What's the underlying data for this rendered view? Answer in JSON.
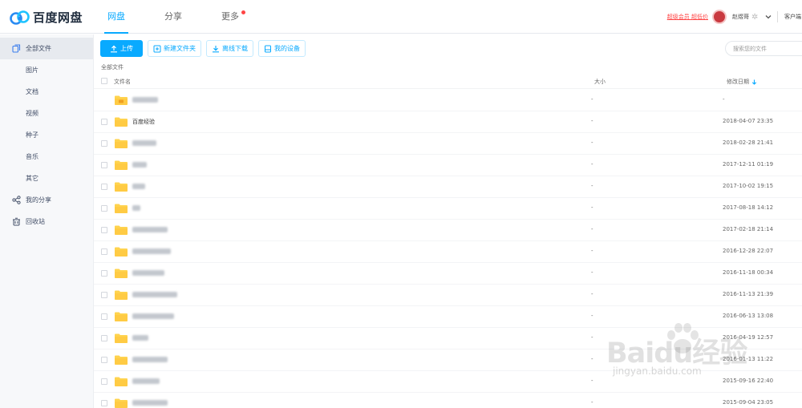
{
  "header": {
    "logo_text": "百度网盘",
    "nav": [
      {
        "label": "网盘",
        "active": true
      },
      {
        "label": "分享",
        "active": false
      },
      {
        "label": "更多",
        "active": false,
        "dot": true
      }
    ],
    "vip_link": "超级会员 超低价",
    "user_name": "赵煜哥",
    "client_link": "客户端"
  },
  "sidebar": {
    "items": [
      {
        "label": "全部文件",
        "icon": "files-icon",
        "active": true
      },
      {
        "label": "图片"
      },
      {
        "label": "文档"
      },
      {
        "label": "视频"
      },
      {
        "label": "种子"
      },
      {
        "label": "音乐"
      },
      {
        "label": "其它"
      },
      {
        "label": "我的分享",
        "icon": "share-icon"
      },
      {
        "label": "回收站",
        "icon": "trash-icon"
      }
    ]
  },
  "toolbar": {
    "upload_label": "上传",
    "new_folder_label": "新建文件夹",
    "offline_download_label": "离线下载",
    "my_devices_label": "我的设备",
    "search_placeholder": "搜索您的文件"
  },
  "breadcrumb": "全部文件",
  "table": {
    "columns": {
      "name": "文件名",
      "size": "大小",
      "date": "修改日期"
    },
    "rows": [
      {
        "name": "",
        "size": "-",
        "date": "-",
        "special": true
      },
      {
        "name": "百度经验",
        "size": "-",
        "date": "2018-04-07 23:35"
      },
      {
        "name": "",
        "size": "-",
        "date": "2018-02-28 21:41"
      },
      {
        "name": "",
        "size": "-",
        "date": "2017-12-11 01:19"
      },
      {
        "name": "",
        "size": "-",
        "date": "2017-10-02 19:15"
      },
      {
        "name": "",
        "size": "-",
        "date": "2017-08-18 14:12"
      },
      {
        "name": "",
        "size": "-",
        "date": "2017-02-18 21:14"
      },
      {
        "name": "",
        "size": "-",
        "date": "2016-12-28 22:07"
      },
      {
        "name": "",
        "size": "-",
        "date": "2016-11-18 00:34"
      },
      {
        "name": "",
        "size": "-",
        "date": "2016-11-13 21:39"
      },
      {
        "name": "",
        "size": "-",
        "date": "2016-06-13 13:08"
      },
      {
        "name": "",
        "size": "-",
        "date": "2016-04-19 12:57"
      },
      {
        "name": "",
        "size": "-",
        "date": "2016-01-13 11:22"
      },
      {
        "name": "",
        "size": "-",
        "date": "2015-09-16 22:40"
      },
      {
        "name": "",
        "size": "-",
        "date": "2015-09-04 23:05"
      }
    ]
  },
  "watermark": {
    "text": "Baidu经验",
    "sub": "jingyan.baidu.com"
  },
  "colors": {
    "accent": "#09aaff",
    "folder": "#ffd34e",
    "sidebar_bg": "#f7f8fa",
    "alert": "#ff4444"
  }
}
